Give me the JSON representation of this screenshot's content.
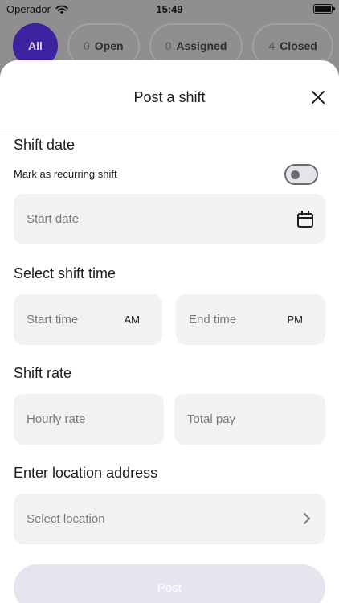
{
  "status_bar": {
    "carrier": "Operador",
    "time": "15:49"
  },
  "filters": [
    {
      "label": "All",
      "count": ""
    },
    {
      "label": "Open",
      "count": "0"
    },
    {
      "label": "Assigned",
      "count": "0"
    },
    {
      "label": "Closed",
      "count": "4"
    }
  ],
  "sheet": {
    "title": "Post a shift",
    "shift_date": {
      "heading": "Shift date",
      "recurring_label": "Mark as recurring shift",
      "recurring_on": false,
      "start_date_placeholder": "Start date"
    },
    "shift_time": {
      "heading": "Select shift time",
      "start_placeholder": "Start time",
      "start_suffix": "AM",
      "end_placeholder": "End time",
      "end_suffix": "PM"
    },
    "shift_rate": {
      "heading": "Shift rate",
      "hourly_placeholder": "Hourly rate",
      "total_placeholder": "Total pay"
    },
    "location": {
      "heading": "Enter location address",
      "placeholder": "Select location"
    },
    "post_button": "Post"
  },
  "colors": {
    "accent": "#3d23a0",
    "field_bg": "#f2f2f4",
    "post_disabled": "#e7e4f0"
  },
  "icons": [
    "wifi-icon",
    "battery-icon",
    "close-icon",
    "calendar-icon",
    "chevron-right-icon"
  ]
}
